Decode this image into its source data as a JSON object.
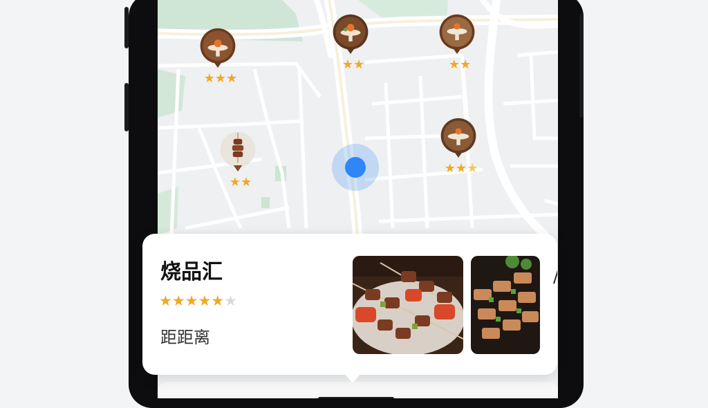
{
  "map": {
    "current_location_label": "",
    "pins": [
      {
        "id": "pin-1",
        "rating": 3,
        "max": 3
      },
      {
        "id": "pin-2",
        "rating": 2,
        "max": 2
      },
      {
        "id": "pin-3",
        "rating": 2,
        "max": 2
      },
      {
        "id": "pin-4",
        "rating": 2,
        "max": 2
      },
      {
        "id": "pin-5",
        "rating": 3,
        "max": 3
      }
    ]
  },
  "card": {
    "name": "烧品汇",
    "rating": 5,
    "rating_max": 6,
    "distance_label": "距距离",
    "next_card_peek": "/"
  },
  "colors": {
    "star": "#f2a825",
    "star_off": "#d9d9d9",
    "location_dot": "#2f86f4",
    "road": "#ffffff",
    "park": "#cfe5d6"
  }
}
